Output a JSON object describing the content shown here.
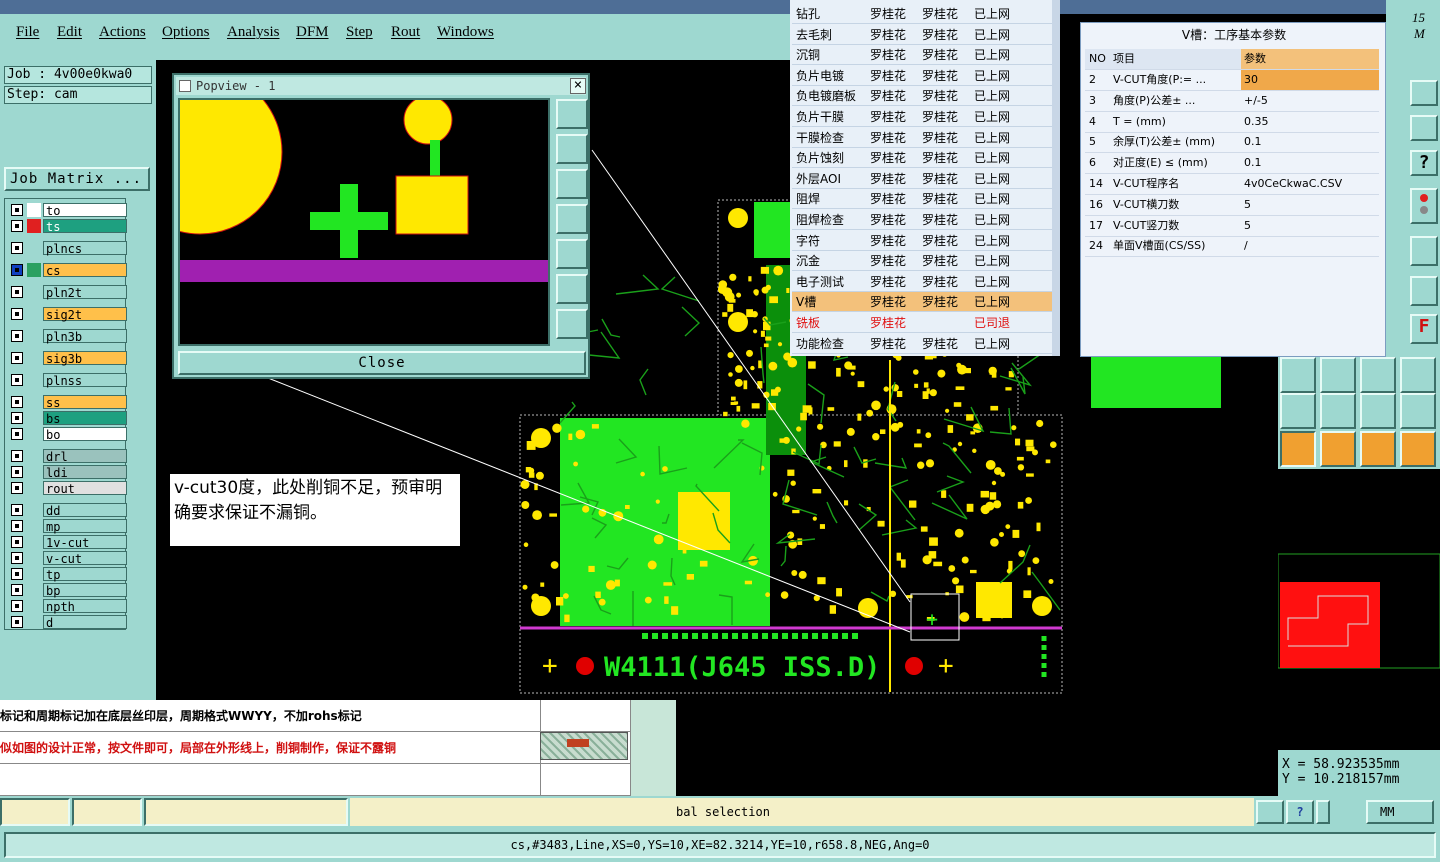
{
  "app": {
    "title_partial": "15",
    "corner_label": "M"
  },
  "menu": [
    "File",
    "Edit",
    "Actions",
    "Options",
    "Analysis",
    "DFM",
    "Step",
    "Rout",
    "Windows"
  ],
  "job": {
    "job_label": "Job : 4v00e0kwa0",
    "step_label": "Step: cam",
    "matrix_button": "Job Matrix ..."
  },
  "layers": [
    {
      "name": "to",
      "color": "#ffffff",
      "swatch": "#ffffff",
      "icon": "pen"
    },
    {
      "name": "ts",
      "color": "#1ea080",
      "swatch": "#e02020"
    },
    {
      "name": "plncs",
      "color": "#9ed8d0"
    },
    {
      "name": "cs",
      "color": "#ffc04a",
      "swatch": "#2aa060",
      "icon": "pen-plus",
      "active": true
    },
    {
      "name": "pln2t",
      "color": "#9ed8d0"
    },
    {
      "name": "sig2t",
      "color": "#ffc04a"
    },
    {
      "name": "pln3b",
      "color": "#9ed8d0"
    },
    {
      "name": "sig3b",
      "color": "#ffc04a"
    },
    {
      "name": "plnss",
      "color": "#9ed8d0"
    },
    {
      "name": "ss",
      "color": "#ffc04a"
    },
    {
      "name": "bs",
      "color": "#1ea080"
    },
    {
      "name": "bo",
      "color": "#ffffff"
    },
    {
      "name": "drl",
      "color": "#9ac2bd"
    },
    {
      "name": "ldi",
      "color": "#9ac2bd"
    },
    {
      "name": "rout",
      "color": "#e0e0e0"
    },
    {
      "name": "dd",
      "color": "#9ed8d0"
    },
    {
      "name": "mp",
      "color": "#9ed8d0"
    },
    {
      "name": "1v-cut",
      "color": "#9ed8d0"
    },
    {
      "name": "v-cut",
      "color": "#9ed8d0"
    },
    {
      "name": "tp",
      "color": "#9ed8d0"
    },
    {
      "name": "bp",
      "color": "#9ed8d0"
    },
    {
      "name": "npth",
      "color": "#9ed8d0"
    },
    {
      "name": "d",
      "color": "#9ed8d0"
    }
  ],
  "popview": {
    "title": "Popview - 1",
    "close": "Close"
  },
  "annotation": {
    "text": "v-cut30度，此处削铜不足，预审明确要求保证不漏铜。"
  },
  "board_text": "W4111(J645 ISS.D)",
  "process_list": [
    {
      "step": "钻孔",
      "a": "罗桂花",
      "b": "罗桂花",
      "status": "已上网"
    },
    {
      "step": "去毛刺",
      "a": "罗桂花",
      "b": "罗桂花",
      "status": "已上网"
    },
    {
      "step": "沉铜",
      "a": "罗桂花",
      "b": "罗桂花",
      "status": "已上网"
    },
    {
      "step": "负片电镀",
      "a": "罗桂花",
      "b": "罗桂花",
      "status": "已上网"
    },
    {
      "step": "负电镀磨板",
      "a": "罗桂花",
      "b": "罗桂花",
      "status": "已上网"
    },
    {
      "step": "负片干膜",
      "a": "罗桂花",
      "b": "罗桂花",
      "status": "已上网"
    },
    {
      "step": "干膜检查",
      "a": "罗桂花",
      "b": "罗桂花",
      "status": "已上网"
    },
    {
      "step": "负片蚀刻",
      "a": "罗桂花",
      "b": "罗桂花",
      "status": "已上网"
    },
    {
      "step": "外层AOI",
      "a": "罗桂花",
      "b": "罗桂花",
      "status": "已上网"
    },
    {
      "step": "阻焊",
      "a": "罗桂花",
      "b": "罗桂花",
      "status": "已上网"
    },
    {
      "step": "阻焊检查",
      "a": "罗桂花",
      "b": "罗桂花",
      "status": "已上网"
    },
    {
      "step": "字符",
      "a": "罗桂花",
      "b": "罗桂花",
      "status": "已上网"
    },
    {
      "step": "沉金",
      "a": "罗桂花",
      "b": "罗桂花",
      "status": "已上网"
    },
    {
      "step": "电子测试",
      "a": "罗桂花",
      "b": "罗桂花",
      "status": "已上网"
    },
    {
      "step": "V槽",
      "a": "罗桂花",
      "b": "罗桂花",
      "status": "已上网",
      "selected": true
    },
    {
      "step": "铣板",
      "a": "罗桂花",
      "b": "",
      "status": "已司退",
      "red": true
    },
    {
      "step": "功能检查",
      "a": "罗桂花",
      "b": "罗桂花",
      "status": "已上网"
    }
  ],
  "vgroove": {
    "title": "V槽：工序基本参数",
    "headers": [
      "NO",
      "项目",
      "参数"
    ],
    "rows": [
      {
        "no": "2",
        "item": "V-CUT角度(P:=  ...",
        "value": "30",
        "selected": true
      },
      {
        "no": "3",
        "item": "角度(P)公差±  ...",
        "value": "+/-5"
      },
      {
        "no": "4",
        "item": "T =  (mm)",
        "value": "0.35"
      },
      {
        "no": "5",
        "item": "余厚(T)公差±  (mm)",
        "value": "0.1"
      },
      {
        "no": "6",
        "item": "对正度(E) ≤ (mm)",
        "value": "0.1"
      },
      {
        "no": "14",
        "item": "V-CUT程序名",
        "value": "4v0CeCkwaC.CSV"
      },
      {
        "no": "16",
        "item": "V-CUT横刀数",
        "value": "5"
      },
      {
        "no": "17",
        "item": "V-CUT竖刀数",
        "value": "5"
      },
      {
        "no": "24",
        "item": "单面V槽面(CS/SS)",
        "value": "/"
      }
    ]
  },
  "coords": {
    "x": "X  =  58.923535mm",
    "y": "Y  =  10.218157mm"
  },
  "bottom_table": [
    {
      "text": "标记和周期标记加在底层丝印层，周期格式WWYY，不加rohs标记",
      "color": "#000000"
    },
    {
      "text": "似如图的设计正常，按文件即可，局部在外形线上，削铜制作，保证不露铜",
      "color": "#d01010"
    },
    {
      "text": "",
      "color": "#000000"
    }
  ],
  "status": {
    "message": "bal selection",
    "units": "MM"
  },
  "command": "cs,#3483,Line,XS=0,YS=10,XE=82.3214,YE=10,r658.8,NEG,Ang=0"
}
